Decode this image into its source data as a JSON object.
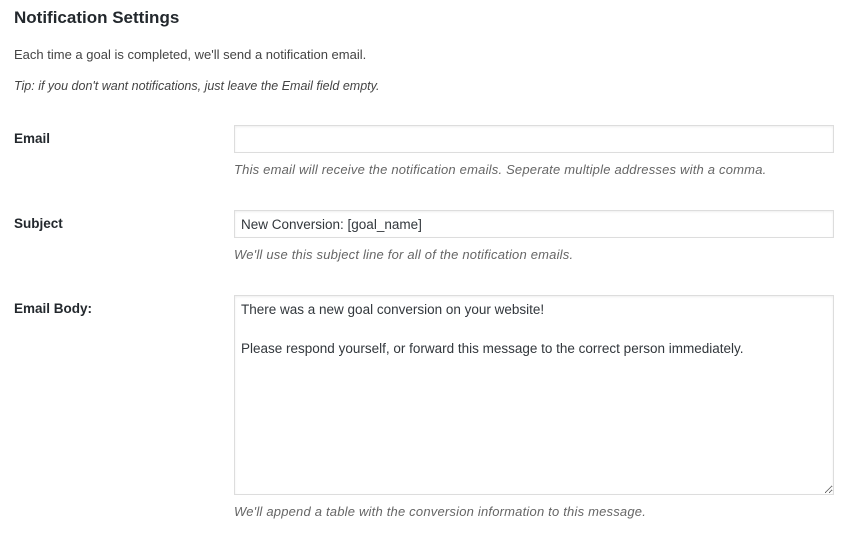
{
  "section": {
    "title": "Notification Settings",
    "intro": "Each time a goal is completed, we'll send a notification email.",
    "tip": "Tip: if you don't want notifications, just leave the Email field empty."
  },
  "fields": {
    "email": {
      "label": "Email",
      "value": "",
      "description": "This email will receive the notification emails. Seperate multiple addresses with a comma."
    },
    "subject": {
      "label": "Subject",
      "value": "New Conversion: [goal_name]",
      "description": "We'll use this subject line for all of the notification emails."
    },
    "body": {
      "label": "Email Body:",
      "value": "There was a new goal conversion on your website!\n\nPlease respond yourself, or forward this message to the correct person immediately.",
      "description": "We'll append a table with the conversion information to this message."
    }
  }
}
